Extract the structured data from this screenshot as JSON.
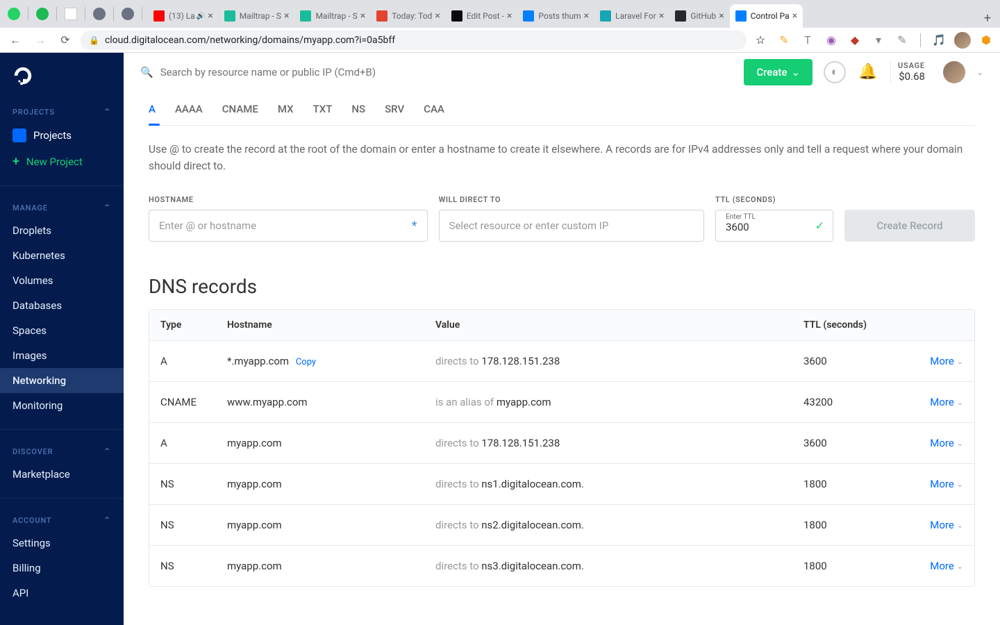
{
  "browser": {
    "pinned": [
      {
        "cls": "fi-wa"
      },
      {
        "cls": "fi-green"
      },
      {
        "cls": "fi-sq"
      },
      {
        "cls": "fi-globe"
      },
      {
        "cls": "fi-globe"
      }
    ],
    "tabs": [
      {
        "icon": "fi-red",
        "title": "(13) La",
        "audio": true
      },
      {
        "icon": "fi-teal",
        "title": "Mailtrap - S"
      },
      {
        "icon": "fi-teal",
        "title": "Mailtrap - S"
      },
      {
        "icon": "fi-todo",
        "title": "Today: Tod"
      },
      {
        "icon": "fi-dev",
        "title": "Edit Post -"
      },
      {
        "icon": "fi-blue",
        "title": "Posts thum"
      },
      {
        "icon": "fi-forge",
        "title": "Laravel For"
      },
      {
        "icon": "fi-gh",
        "title": "GitHub"
      },
      {
        "icon": "fi-do",
        "title": "Control Pa",
        "active": true
      }
    ],
    "url": "cloud.digitalocean.com/networking/domains/myapp.com?i=0a5bff"
  },
  "sidebar": {
    "projects_hdr": "PROJECTS",
    "projects_item": "Projects",
    "new_project": "New Project",
    "manage_hdr": "MANAGE",
    "manage_items": [
      "Droplets",
      "Kubernetes",
      "Volumes",
      "Databases",
      "Spaces",
      "Images",
      "Networking",
      "Monitoring"
    ],
    "active_manage": "Networking",
    "discover_hdr": "DISCOVER",
    "discover_items": [
      "Marketplace"
    ],
    "account_hdr": "ACCOUNT",
    "account_items": [
      "Settings",
      "Billing",
      "API"
    ]
  },
  "topbar": {
    "search_placeholder": "Search by resource name or public IP (Cmd+B)",
    "create_label": "Create",
    "usage_label": "USAGE",
    "usage_value": "$0.68"
  },
  "record_tabs": [
    "A",
    "AAAA",
    "CNAME",
    "MX",
    "TXT",
    "NS",
    "SRV",
    "CAA"
  ],
  "active_record_tab": "A",
  "help_text": "Use @ to create the record at the root of the domain or enter a hostname to create it elsewhere. A records are for IPv4 addresses only and tell a request where your domain should direct to.",
  "form": {
    "hostname_label": "HOSTNAME",
    "hostname_placeholder": "Enter @ or hostname",
    "direct_label": "WILL DIRECT TO",
    "direct_placeholder": "Select resource or enter custom IP",
    "ttl_label": "TTL (SECONDS)",
    "ttl_inner_label": "Enter TTL",
    "ttl_value": "3600",
    "create_record": "Create Record"
  },
  "dns": {
    "title": "DNS records",
    "headers": {
      "type": "Type",
      "hostname": "Hostname",
      "value": "Value",
      "ttl": "TTL (seconds)"
    },
    "copy_label": "Copy",
    "more_label": "More",
    "rows": [
      {
        "type": "A",
        "host": "*.myapp.com",
        "copy": true,
        "pre": "directs to ",
        "val": "178.128.151.238",
        "ttl": "3600"
      },
      {
        "type": "CNAME",
        "host": "www.myapp.com",
        "pre": "is an alias of ",
        "val": "myapp.com",
        "ttl": "43200"
      },
      {
        "type": "A",
        "host": "myapp.com",
        "pre": "directs to ",
        "val": "178.128.151.238",
        "ttl": "3600"
      },
      {
        "type": "NS",
        "host": "myapp.com",
        "pre": "directs to ",
        "val": "ns1.digitalocean.com.",
        "ttl": "1800"
      },
      {
        "type": "NS",
        "host": "myapp.com",
        "pre": "directs to ",
        "val": "ns2.digitalocean.com.",
        "ttl": "1800"
      },
      {
        "type": "NS",
        "host": "myapp.com",
        "pre": "directs to ",
        "val": "ns3.digitalocean.com.",
        "ttl": "1800"
      }
    ]
  }
}
